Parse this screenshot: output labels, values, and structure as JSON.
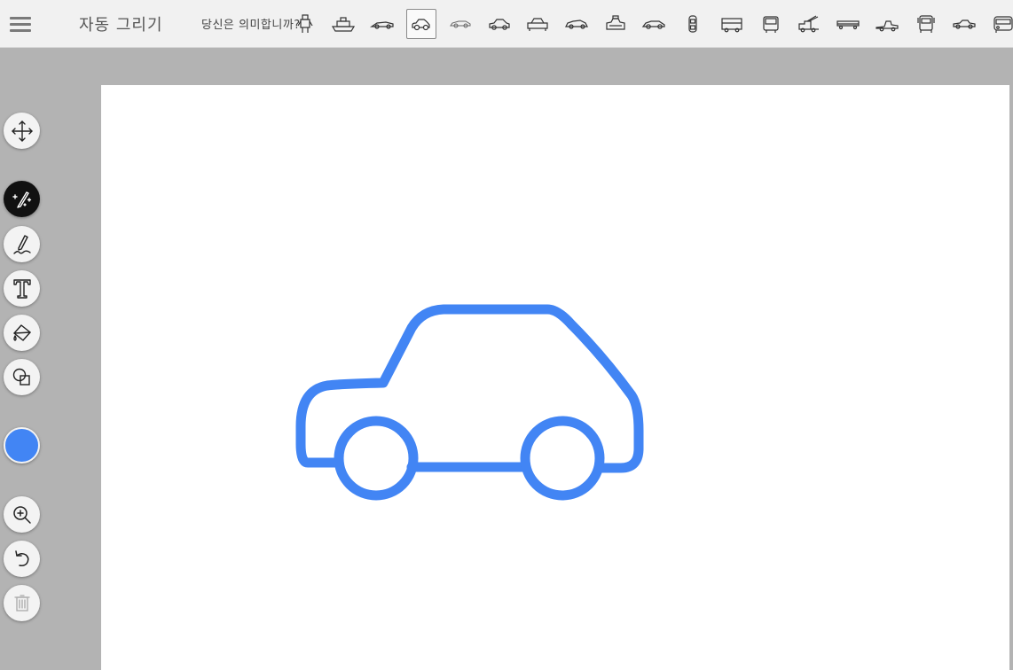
{
  "app": {
    "title": "자동 그리기",
    "menu_icon": "hamburger-menu-icon"
  },
  "suggestions": {
    "label": "당신은 의미합니까?",
    "selected_index": 2,
    "items": [
      {
        "icon": "robot-figure-icon"
      },
      {
        "icon": "boat-icon"
      },
      {
        "icon": "car-icon"
      },
      {
        "icon": "low-sports-car-icon"
      },
      {
        "icon": "hatchback-car-icon"
      },
      {
        "icon": "sedan-front-car-icon"
      },
      {
        "icon": "coupe-car-icon"
      },
      {
        "icon": "taxi-car-icon"
      },
      {
        "icon": "race-car-icon"
      },
      {
        "icon": "car-top-view-icon"
      },
      {
        "icon": "bus-icon"
      },
      {
        "icon": "tram-icon"
      },
      {
        "icon": "fire-truck-icon"
      },
      {
        "icon": "long-truck-icon"
      },
      {
        "icon": "tow-truck-icon"
      },
      {
        "icon": "semi-truck-front-icon"
      },
      {
        "icon": "pickup-truck-icon"
      },
      {
        "icon": "bus-front-icon"
      }
    ]
  },
  "tools": [
    {
      "name": "move-tool",
      "icon": "move-arrows-icon"
    },
    {
      "name": "autodraw-tool",
      "icon": "magic-pen-icon",
      "active": true
    },
    {
      "name": "draw-tool",
      "icon": "pencil-icon"
    },
    {
      "name": "type-tool",
      "icon": "text-t-icon"
    },
    {
      "name": "fill-tool",
      "icon": "paint-bucket-icon"
    },
    {
      "name": "shape-tool",
      "icon": "shapes-icon"
    },
    {
      "name": "zoom-tool",
      "icon": "zoom-in-icon"
    },
    {
      "name": "undo-tool",
      "icon": "undo-icon"
    },
    {
      "name": "delete-tool",
      "icon": "trash-icon",
      "disabled": true
    }
  ],
  "colors": {
    "stroke": "#4285f4",
    "selected_color": "#4285f4",
    "canvas_bg": "#ffffff",
    "workspace_bg": "#b3b3b3"
  },
  "canvas": {
    "drawing": "car"
  }
}
